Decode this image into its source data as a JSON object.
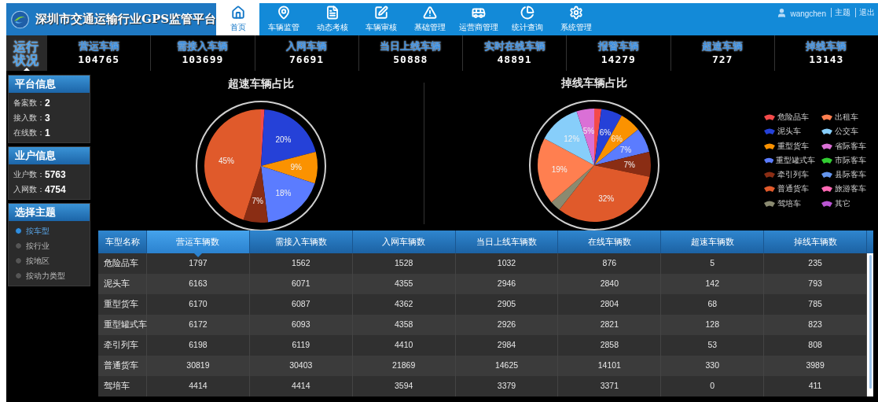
{
  "header": {
    "title": "深圳市交通运输行业GPS监管平台",
    "nav": [
      {
        "label": "首页",
        "selected": true
      },
      {
        "label": "车辆监管",
        "selected": false
      },
      {
        "label": "动态考核",
        "selected": false
      },
      {
        "label": "车辆审核",
        "selected": false
      },
      {
        "label": "基础管理",
        "selected": false
      },
      {
        "label": "运营商管理",
        "selected": false
      },
      {
        "label": "统计查询",
        "selected": false
      },
      {
        "label": "系统管理",
        "selected": false
      }
    ],
    "user": {
      "name": "wangchen",
      "links": [
        "主题",
        "退出"
      ]
    }
  },
  "status_bar": {
    "label": "运行状况",
    "stats": [
      {
        "label": "营运车辆",
        "value": "104765"
      },
      {
        "label": "需接入车辆",
        "value": "103699"
      },
      {
        "label": "入网车辆",
        "value": "76691"
      },
      {
        "label": "当日上线车辆",
        "value": "50888"
      },
      {
        "label": "实时在线车辆",
        "value": "48891"
      },
      {
        "label": "报警车辆",
        "value": "14279"
      },
      {
        "label": "超速车辆",
        "value": "727"
      },
      {
        "label": "掉线车辆",
        "value": "13143"
      }
    ]
  },
  "sidebar": {
    "panels": [
      {
        "kind": "info",
        "title": "平台信息",
        "items": [
          {
            "label": "备案数：",
            "value": "2"
          },
          {
            "label": "接入数：",
            "value": "3"
          },
          {
            "label": "在线数：",
            "value": "1"
          }
        ]
      },
      {
        "kind": "info",
        "title": "业户信息",
        "items": [
          {
            "label": "业户数：",
            "value": "5763"
          },
          {
            "label": "入网数：",
            "value": "4754"
          }
        ]
      },
      {
        "kind": "radio",
        "title": "选择主题",
        "options": [
          {
            "label": "按车型",
            "selected": true
          },
          {
            "label": "按行业",
            "selected": false
          },
          {
            "label": "按地区",
            "selected": false
          },
          {
            "label": "按动力类型",
            "selected": false
          }
        ]
      }
    ]
  },
  "charts": [
    {
      "chart_data": {
        "type": "pie",
        "title": "超速车辆占比",
        "values": [
          1,
          20,
          9,
          18,
          7,
          45
        ],
        "colors": [
          "#f44a4a",
          "#2541d8",
          "#fb9200",
          "#5b7cff",
          "#8a2d14",
          "#e05a2b"
        ],
        "value_labels": [
          null,
          "20%",
          "9%",
          "18%",
          "7%",
          "45%"
        ]
      }
    },
    {
      "chart_data": {
        "type": "pie",
        "title": "掉线车辆占比",
        "values": [
          2,
          6,
          6,
          7,
          7,
          32,
          3,
          19,
          12,
          5
        ],
        "colors": [
          "#f44a4a",
          "#2541d8",
          "#fb9200",
          "#5b7cff",
          "#8a2d14",
          "#e05a2b",
          "#8a8a70",
          "#ff7f50",
          "#87cefa",
          "#da70d6"
        ],
        "value_labels": [
          null,
          "6%",
          "6%",
          "7%",
          "7%",
          "32%",
          null,
          "19%",
          "12%",
          "5%"
        ]
      },
      "legend": [
        {
          "label": "危险品车",
          "color": "#f44a4a"
        },
        {
          "label": "出租车",
          "color": "#ff7f50"
        },
        {
          "label": "泥头车",
          "color": "#2541d8"
        },
        {
          "label": "公交车",
          "color": "#87cefa"
        },
        {
          "label": "重型货车",
          "color": "#fb9200"
        },
        {
          "label": "省际客车",
          "color": "#da70d6"
        },
        {
          "label": "重型罐式车",
          "color": "#5b7cff"
        },
        {
          "label": "市际客车",
          "color": "#32cd32"
        },
        {
          "label": "牵引列车",
          "color": "#8a2d14"
        },
        {
          "label": "县际客车",
          "color": "#6495ed"
        },
        {
          "label": "普通货车",
          "color": "#e05a2b"
        },
        {
          "label": "旅游客车",
          "color": "#ff69b4"
        },
        {
          "label": "驾培车",
          "color": "#8a8a70"
        },
        {
          "label": "其它",
          "color": "#ba55d3"
        }
      ]
    }
  ],
  "table": {
    "columns": [
      {
        "label": "车型名称",
        "selected": false
      },
      {
        "label": "营运车辆数",
        "selected": true
      },
      {
        "label": "需接入车辆数",
        "selected": false
      },
      {
        "label": "入网车辆数",
        "selected": false
      },
      {
        "label": "当日上线车辆数",
        "selected": false
      },
      {
        "label": "在线车辆数",
        "selected": false
      },
      {
        "label": "超速车辆数",
        "selected": false
      },
      {
        "label": "掉线车辆数",
        "selected": false
      }
    ],
    "rows": [
      [
        "危险品车",
        "1797",
        "1562",
        "1528",
        "1032",
        "876",
        "5",
        "235"
      ],
      [
        "泥头车",
        "6163",
        "6071",
        "4355",
        "2946",
        "2840",
        "142",
        "793"
      ],
      [
        "重型货车",
        "6170",
        "6087",
        "4362",
        "2905",
        "2804",
        "68",
        "785"
      ],
      [
        "重型罐式车",
        "6172",
        "6093",
        "4358",
        "2926",
        "2821",
        "128",
        "823"
      ],
      [
        "牵引列车",
        "6198",
        "6119",
        "4410",
        "2984",
        "2858",
        "53",
        "808"
      ],
      [
        "普通货车",
        "30819",
        "30403",
        "21869",
        "14625",
        "14101",
        "330",
        "3989"
      ],
      [
        "驾培车",
        "4414",
        "4414",
        "3594",
        "3379",
        "3371",
        "0",
        "411"
      ]
    ]
  }
}
